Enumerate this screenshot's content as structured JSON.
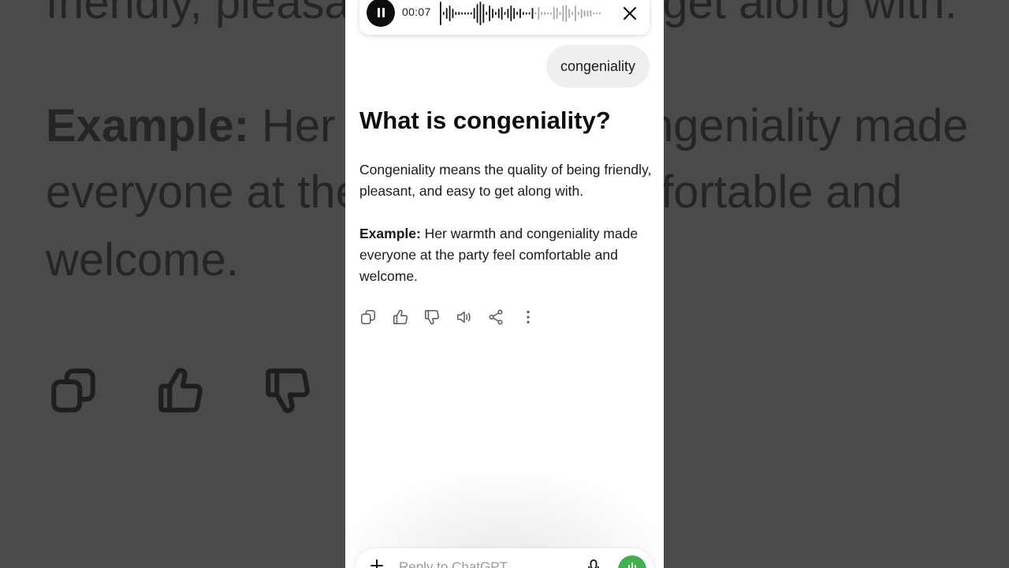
{
  "background": {
    "line1": "friendly, pleasant, and easy to get along with.",
    "line2_bold": "Example:",
    "line2_rest": " Her warmth and congeniality made",
    "line3": "everyone at the party feel comfortable and",
    "line4": "welcome."
  },
  "player": {
    "elapsed": "00:07"
  },
  "user_message": "congeniality",
  "answer": {
    "title": "What is congeniality?",
    "paragraph1": "Congeniality means the quality of being friendly, pleasant, and easy to get along with.",
    "example_label": "Example:",
    "example_text": " Her warmth and congeniality made everyone at the party feel comfortable and welcome."
  },
  "actions": [
    "copy-icon",
    "thumbs-up-icon",
    "thumbs-down-icon",
    "read-aloud-icon",
    "share-icon",
    "more-icon"
  ],
  "composer": {
    "placeholder": "Reply to ChatGPT"
  },
  "colors": {
    "accent_voice": "#3fb24f",
    "bubble": "#efefef",
    "backdrop": "#4b4b4b"
  }
}
